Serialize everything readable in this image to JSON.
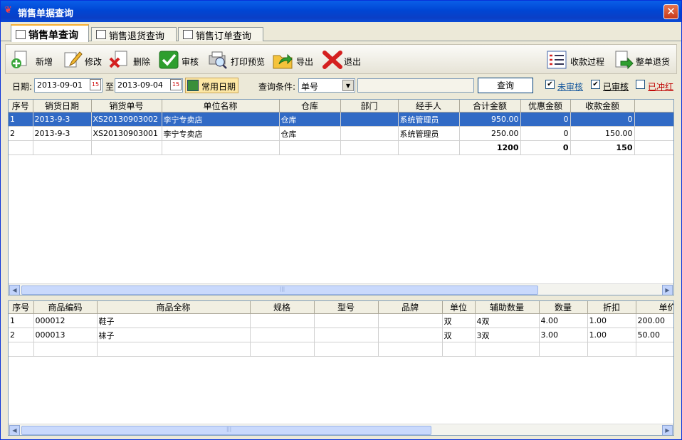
{
  "window": {
    "title": "销售单据查询"
  },
  "tabs": [
    "销售单查询",
    "销售退货查询",
    "销售订单查询"
  ],
  "toolbar": {
    "add": "新增",
    "edit": "修改",
    "delete": "删除",
    "audit": "审核",
    "print_preview": "打印预览",
    "export": "导出",
    "exit": "退出",
    "payment_process": "收款过程",
    "full_return": "整单退货"
  },
  "filter": {
    "date_label": "日期:",
    "date_from": "2013-09-01",
    "to_label": "至",
    "date_to": "2013-09-04",
    "common_dates": "常用日期",
    "condition_label": "查询条件:",
    "condition_value": "单号",
    "search_value": "",
    "search_button": "查询",
    "unaudited": "未审核",
    "audited": "已审核",
    "reversed": "已冲红"
  },
  "checkboxes": {
    "unaudited": true,
    "audited": true,
    "reversed": false
  },
  "main_table": {
    "columns": [
      "序号",
      "销货日期",
      "销货单号",
      "单位名称",
      "仓库",
      "部门",
      "经手人",
      "合计金额",
      "优惠金额",
      "收款金额"
    ],
    "rows": [
      [
        "1",
        "2013-9-3",
        "XS20130903002",
        "李宁专卖店",
        "仓库",
        "",
        "系统管理员",
        "950.00",
        "0",
        "0"
      ],
      [
        "2",
        "2013-9-3",
        "XS20130903001",
        "李宁专卖店",
        "仓库",
        "",
        "系统管理员",
        "250.00",
        "0",
        "150.00"
      ]
    ],
    "totals": [
      "",
      "",
      "",
      "",
      "",
      "",
      "",
      "1200",
      "0",
      "150"
    ]
  },
  "detail_table": {
    "columns": [
      "序号",
      "商品编码",
      "商品全称",
      "规格",
      "型号",
      "品牌",
      "单位",
      "辅助数量",
      "数量",
      "折扣",
      "单价"
    ],
    "rows": [
      [
        "1",
        "000012",
        "鞋子",
        "",
        "",
        "",
        "双",
        "4双",
        "4.00",
        "1.00",
        "200.00"
      ],
      [
        "2",
        "000013",
        "袜子",
        "",
        "",
        "",
        "双",
        "3双",
        "3.00",
        "1.00",
        "50.00"
      ]
    ]
  },
  "colors": {
    "title_bar": "#0054e3",
    "selected_row": "#316ac5",
    "reversed_text": "#c00000"
  }
}
